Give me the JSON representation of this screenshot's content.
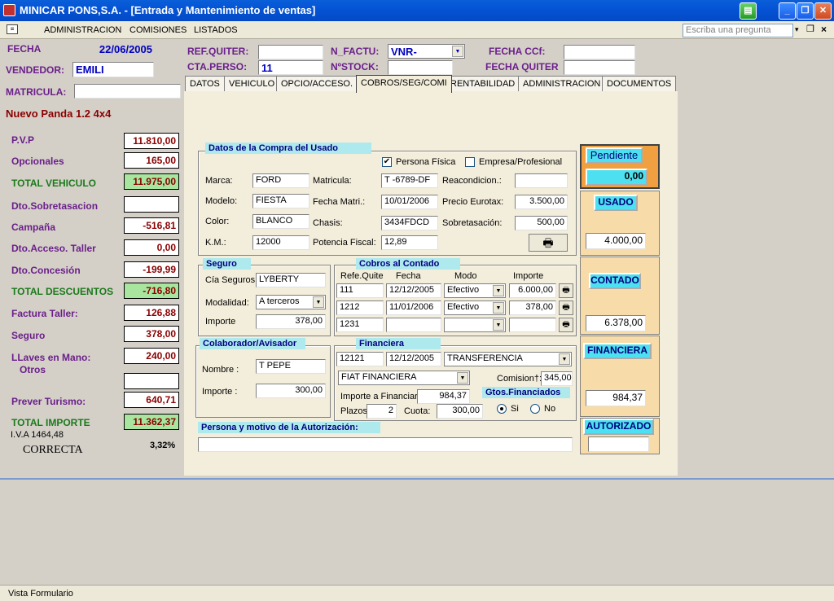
{
  "window": {
    "title": "MINICAR PONS,S.A. - [Entrada y Mantenimiento de ventas]"
  },
  "menu": {
    "items": [
      "ADMINISTRACION",
      "COMISIONES",
      "LISTADOS"
    ],
    "ask_placeholder": "Escriba una pregunta"
  },
  "header": {
    "fecha_label": "FECHA",
    "fecha": "22/06/2005",
    "vendedor_label": "VENDEDOR:",
    "vendedor": "EMILI",
    "matricula_label": "MATRICULA:",
    "matricula": "",
    "model": "Nuevo Panda 1.2 4x4",
    "ref_quiter_label": "REF.QUITER:",
    "ref_quiter": "",
    "cta_perso_label": "CTA.PERSO:",
    "cta_perso": "11",
    "n_factu_label": "N_FACTU:",
    "n_factu": "VNR-",
    "nstock_label": "NºSTOCK:",
    "nstock": "",
    "fecha_ccf_label": "FECHA CCf:",
    "fecha_ccf": "",
    "fecha_quiter_label": "FECHA QUITER",
    "fecha_quiter": ""
  },
  "prices": [
    {
      "label": "P.V.P",
      "value": "11.810,00",
      "green": false
    },
    {
      "label": "Opcionales",
      "value": "165,00",
      "green": false
    },
    {
      "label": "TOTAL VEHICULO",
      "value": "11.975,00",
      "green": true
    },
    {
      "label": "Dto.Sobretasacion",
      "value": "",
      "green": false
    },
    {
      "label": "Campaña",
      "value": "-516,81",
      "green": false
    },
    {
      "label": "Dto.Acceso. Taller",
      "value": "0,00",
      "green": false
    },
    {
      "label": "Dto.Concesión",
      "value": "-199,99",
      "green": false
    },
    {
      "label": "TOTAL DESCUENTOS",
      "value": "-716,80",
      "green": true
    },
    {
      "label": "Factura Taller:",
      "value": "126,88",
      "green": false
    },
    {
      "label": "Seguro",
      "value": "378,00",
      "green": false
    },
    {
      "label": "LLaves en Mano:",
      "value": "240,00",
      "green": false
    },
    {
      "label": "Otros",
      "value": "",
      "green": false
    },
    {
      "label": "Prever Turismo:",
      "value": "640,71",
      "green": false
    },
    {
      "label": "TOTAL IMPORTE",
      "value": "11.362,37",
      "green": true
    }
  ],
  "iva": "I.V.A 1464,48",
  "status": "CORRECTA",
  "percent": "3,32%",
  "tabs": [
    "DATOS",
    "VEHICULO",
    "OPCIO/ACCESO.",
    "COBROS/SEG/COMI",
    "RENTABILIDAD",
    "ADMINISTRACION",
    "DOCUMENTOS"
  ],
  "compra": {
    "title": "Datos de la Compra del Usado",
    "persona_fisica": "Persona Física",
    "empresa": "Empresa/Profesional",
    "marca_l": "Marca:",
    "marca": "FORD",
    "modelo_l": "Modelo:",
    "modelo": "FIESTA",
    "color_l": "Color:",
    "color": "BLANCO",
    "km_l": "K.M.:",
    "km": "12000",
    "matricula_l": "Matricula:",
    "matricula": "T -6789-DF",
    "fmatri_l": "Fecha Matri.:",
    "fmatri": "10/01/2006",
    "chasis_l": "Chasis:",
    "chasis": "3434FDCD",
    "potencia_l": "Potencia Fiscal:",
    "potencia": "12,89",
    "reacond_l": "Reacondicion.:",
    "reacond": "",
    "eurotax_l": "Precio Eurotax:",
    "eurotax": "3.500,00",
    "sobretas_l": "Sobretasación:",
    "sobretas": "500,00"
  },
  "seguro": {
    "title": "Seguro",
    "cia_l": "Cía Seguros",
    "cia": "LYBERTY",
    "modalidad_l": "Modalidad:",
    "modalidad": "A terceros",
    "importe_l": "Importe",
    "importe": "378,00"
  },
  "cobros": {
    "title": "Cobros al Contado",
    "h_ref": "Refe.Quite",
    "h_fecha": "Fecha",
    "h_modo": "Modo",
    "h_importe": "Importe",
    "rows": [
      {
        "ref": "111",
        "fecha": "12/12/2005",
        "modo": "Efectivo",
        "importe": "6.000,00"
      },
      {
        "ref": "1212",
        "fecha": "11/01/2006",
        "modo": "Efectivo",
        "importe": "378,00"
      },
      {
        "ref": "1231",
        "fecha": "",
        "modo": "",
        "importe": ""
      }
    ]
  },
  "colab": {
    "title": "Colaborador/Avisador",
    "nombre_l": "Nombre :",
    "nombre": "T PEPE",
    "importe_l": "Importe :",
    "importe": "300,00"
  },
  "financiera": {
    "title": "Financiera",
    "ref": "12121",
    "fecha": "12/12/2005",
    "modo": "TRANSFERENCIA",
    "entidad": "FIAT FINANCIERA",
    "comision_l": "Comision†:",
    "comision": "345,00",
    "importe_l": "Importe a Financiar",
    "importe": "984,37",
    "gtos_l": "Gtos.Financiados",
    "plazos_l": "Plazos",
    "plazos": "2",
    "cuota_l": "Cuota:",
    "cuota": "300,00",
    "si": "Si",
    "no": "No"
  },
  "autorizacion": {
    "title": "Persona y motivo de la Autorización:",
    "value": ""
  },
  "right": {
    "pendiente": "Pendiente",
    "pendiente_val": "0,00",
    "usado": "USADO",
    "usado_val": "4.000,00",
    "contado": "CONTADO",
    "contado_val": "6.378,00",
    "financiera": "FINANCIERA",
    "financiera_val": "984,37",
    "autorizado": "AUTORIZADO",
    "autorizado_val": ""
  },
  "statusbar": "Vista Formulario"
}
